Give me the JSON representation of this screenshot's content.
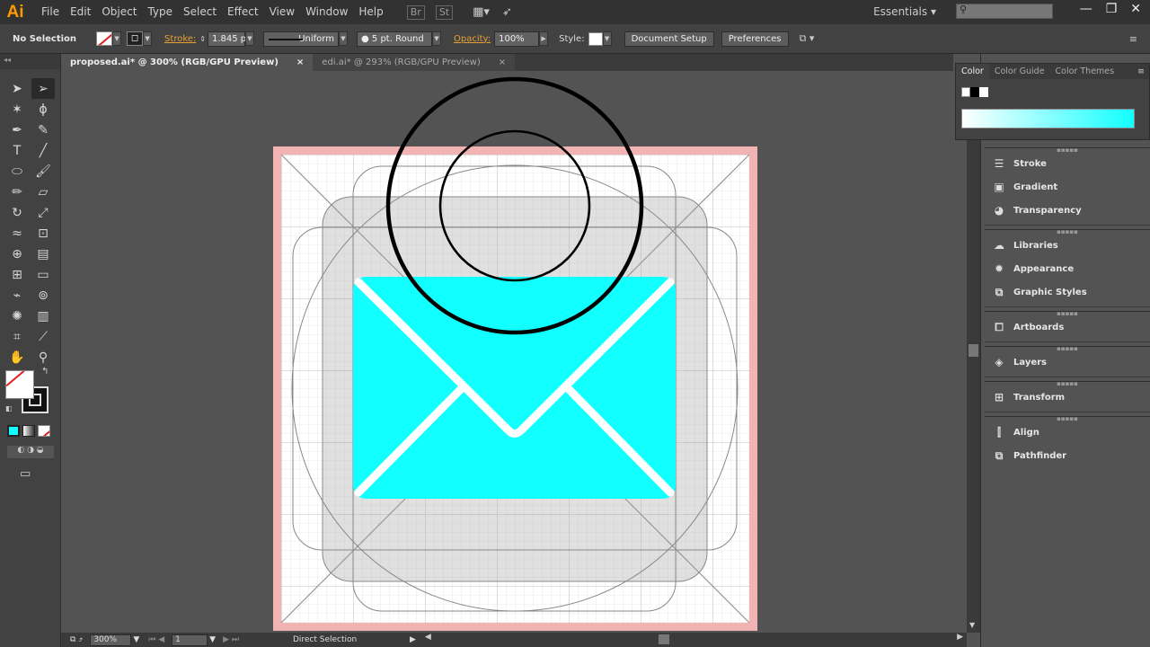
{
  "app": {
    "logo": "Ai"
  },
  "menu": [
    "File",
    "Edit",
    "Object",
    "Type",
    "Select",
    "Effect",
    "View",
    "Window",
    "Help"
  ],
  "menubar_icons": [
    "Br",
    "St"
  ],
  "workspace": "Essentials",
  "control": {
    "selection": "No Selection",
    "stroke_label": "Stroke:",
    "stroke_value": "1.845 pt",
    "profile": "Uniform",
    "brush": "5 pt. Round",
    "opacity_label": "Opacity:",
    "opacity_value": "100%",
    "style_label": "Style:",
    "doc_setup": "Document Setup",
    "preferences": "Preferences"
  },
  "tabs": [
    {
      "label": "proposed.ai* @ 300% (RGB/GPU Preview)",
      "close": "×"
    },
    {
      "label": "edi.ai* @ 293% (RGB/GPU Preview)",
      "close": "×"
    }
  ],
  "status": {
    "zoom": "300%",
    "artboard": "1",
    "tool": "Direct Selection"
  },
  "color_panel": {
    "tabs": [
      "Color",
      "Color Guide",
      "Color Themes"
    ],
    "fill_color": "#12ffff"
  },
  "panels": [
    [
      "Stroke",
      "Gradient",
      "Transparency"
    ],
    [
      "Libraries",
      "Appearance",
      "Graphic Styles"
    ],
    [
      "Artboards"
    ],
    [
      "Layers"
    ],
    [
      "Transform"
    ],
    [
      "Align",
      "Pathfinder"
    ]
  ],
  "canvas": {
    "envelope_color": "#12ffff",
    "bleed_color": "#f2b3b3"
  }
}
